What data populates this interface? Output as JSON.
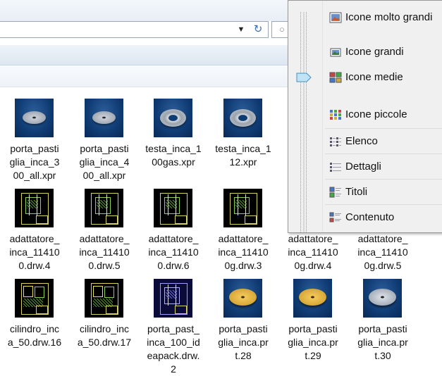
{
  "window": {
    "addressbar": {
      "dropdown_glyph": "▼",
      "refresh_glyph": "↻"
    },
    "search": {
      "glyph": "○"
    }
  },
  "files": [
    {
      "name": "porta_pasti\nglia_inca_3\n00_all.xpr",
      "thumb": "disc"
    },
    {
      "name": "porta_pasti\nglia_inca_4\n00_all.xpr",
      "thumb": "disc"
    },
    {
      "name": "testa_inca_1\n00gas.xpr",
      "thumb": "ring"
    },
    {
      "name": "testa_inca_1\n12.xpr",
      "thumb": "ring"
    },
    {
      "name": "adattatore_\ninca_11410\n0.drw.4",
      "thumb": "drawing"
    },
    {
      "name": "adattatore_\ninca_11410\n0.drw.5",
      "thumb": "drawing"
    },
    {
      "name": "adattatore_\ninca_11410\n0.drw.6",
      "thumb": "drawing"
    },
    {
      "name": "adattatore_\ninca_11410\n0g.drw.3",
      "thumb": "drawing"
    },
    {
      "name": "adattatore_\ninca_11410\n0g.drw.4",
      "thumb": "drawing"
    },
    {
      "name": "adattatore_\ninca_11410\n0g.drw.5",
      "thumb": "drawing"
    },
    {
      "name": "cilindro_inc\na_50.drw.16",
      "thumb": "drawing-cyl"
    },
    {
      "name": "cilindro_inc\na_50.drw.17",
      "thumb": "drawing-cyl"
    },
    {
      "name": "porta_past_\ninca_100_id\neapack.drw.\n2",
      "thumb": "drawing-ideapack"
    },
    {
      "name": "porta_pasti\nglia_inca.pr\nt.28",
      "thumb": "gold-disc"
    },
    {
      "name": "porta_pasti\nglia_inca.pr\nt.29",
      "thumb": "gold-disc"
    },
    {
      "name": "porta_pasti\nglia_inca.pr\nt.30",
      "thumb": "silver-disc"
    }
  ],
  "view_menu": {
    "items": [
      {
        "label": "Icone molto grandi",
        "icon": "extra-large-icons-icon"
      },
      {
        "label": "Icone grandi",
        "icon": "large-icons-icon"
      },
      {
        "label": "Icone medie",
        "icon": "medium-icons-icon"
      },
      {
        "label": "Icone piccole",
        "icon": "small-icons-icon"
      },
      {
        "label": "Elenco",
        "icon": "list-icon"
      },
      {
        "label": "Dettagli",
        "icon": "details-icon"
      },
      {
        "label": "Titoli",
        "icon": "tiles-icon"
      },
      {
        "label": "Contenuto",
        "icon": "content-icon"
      }
    ],
    "slider_selected": "Icone medie"
  }
}
